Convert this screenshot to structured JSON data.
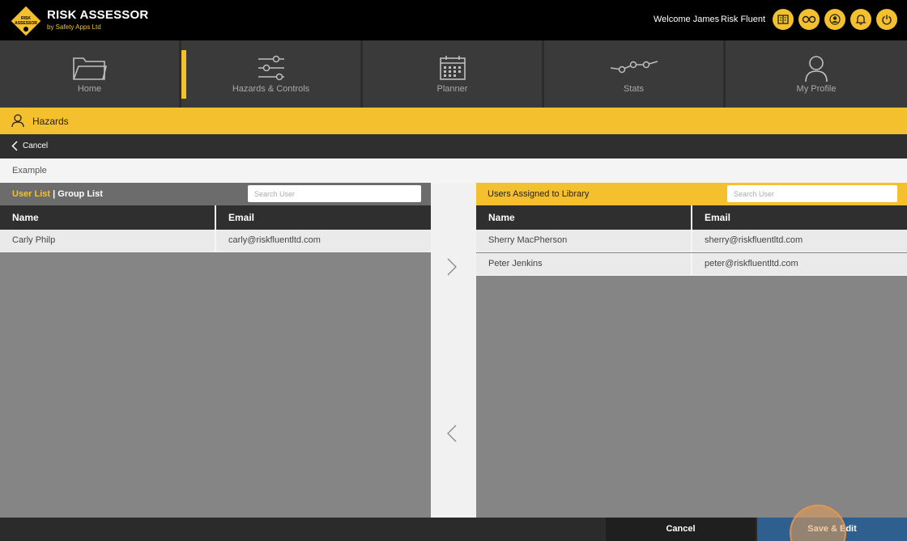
{
  "brand": {
    "title": "RISK ASSESSOR",
    "subtitle": "by Safety Apps Ltd",
    "logo_text_1": "RISK",
    "logo_text_2": "ASSESSOR"
  },
  "header": {
    "welcome": "Welcome James",
    "company": "Risk Fluent",
    "icons": [
      "book-icon",
      "glasses-icon",
      "user-icon",
      "bell-icon",
      "power-icon"
    ]
  },
  "nav": {
    "tabs": [
      {
        "label": "Home",
        "icon": "folder-icon"
      },
      {
        "label": "Hazards & Controls",
        "icon": "sliders-icon",
        "active": true
      },
      {
        "label": "Planner",
        "icon": "calendar-icon"
      },
      {
        "label": "Stats",
        "icon": "chart-line-icon"
      },
      {
        "label": "My Profile",
        "icon": "user-icon"
      }
    ]
  },
  "section": {
    "title": "Hazards"
  },
  "actions": {
    "cancel": "Cancel"
  },
  "library": {
    "name": "Example"
  },
  "left": {
    "tab_user": "User List",
    "tab_sep": "|",
    "tab_group": "Group List",
    "search_placeholder": "Search User",
    "columns": [
      "Name",
      "Email"
    ],
    "rows": [
      {
        "name": "Carly Philp",
        "email": "carly@riskfluentltd.com"
      }
    ]
  },
  "right": {
    "title": "Users Assigned to Library",
    "search_placeholder": "Search User",
    "columns": [
      "Name",
      "Email"
    ],
    "rows": [
      {
        "name": "Sherry MacPherson",
        "email": "sherry@riskfluentltd.com"
      },
      {
        "name": "Peter Jenkins",
        "email": "peter@riskfluentltd.com"
      }
    ]
  },
  "footer": {
    "cancel": "Cancel",
    "save": "Save & Edit"
  },
  "colors": {
    "accent": "#f5c02d",
    "save": "#2f5f8f",
    "dark": "#2b2b2b"
  }
}
